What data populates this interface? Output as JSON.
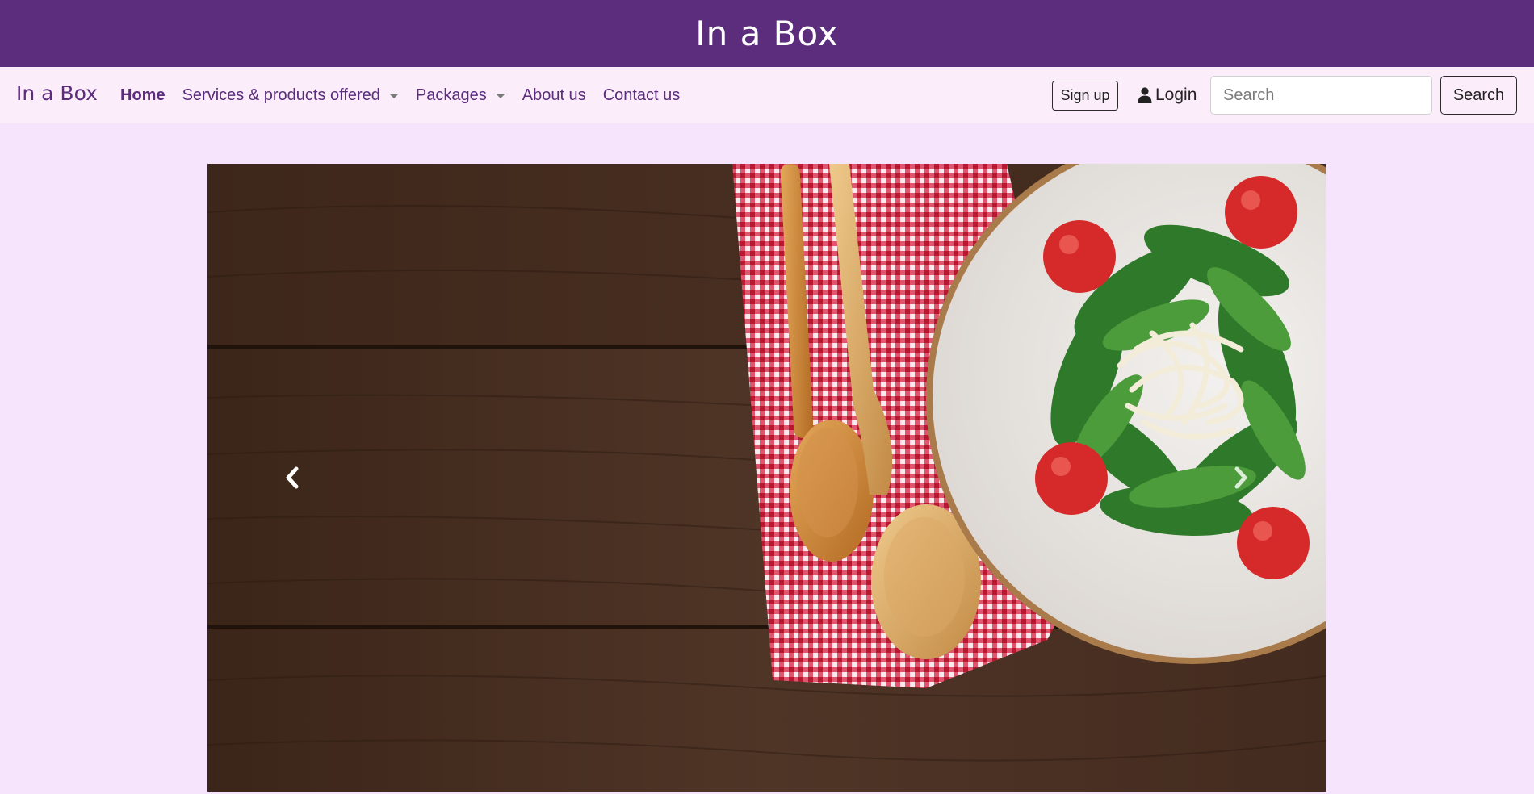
{
  "banner": {
    "title": "In a Box"
  },
  "navbar": {
    "brand": "In a Box",
    "links": [
      {
        "label": "Home",
        "active": true,
        "dropdown": false
      },
      {
        "label": "Services & products offered",
        "active": false,
        "dropdown": true
      },
      {
        "label": "Packages",
        "active": false,
        "dropdown": true
      },
      {
        "label": "About us",
        "active": false,
        "dropdown": false
      },
      {
        "label": "Contact us",
        "active": false,
        "dropdown": false
      }
    ],
    "signup_label": "Sign up",
    "login_label": "Login",
    "search_placeholder": "Search",
    "search_button_label": "Search"
  },
  "carousel": {
    "prev_icon": "chevron-left-icon",
    "next_icon": "chevron-right-icon"
  },
  "colors": {
    "banner_bg": "#5b2d7c",
    "navbar_bg": "#fcedfb",
    "page_bg": "#f5e4fc",
    "link_color": "#5b2d7c"
  }
}
